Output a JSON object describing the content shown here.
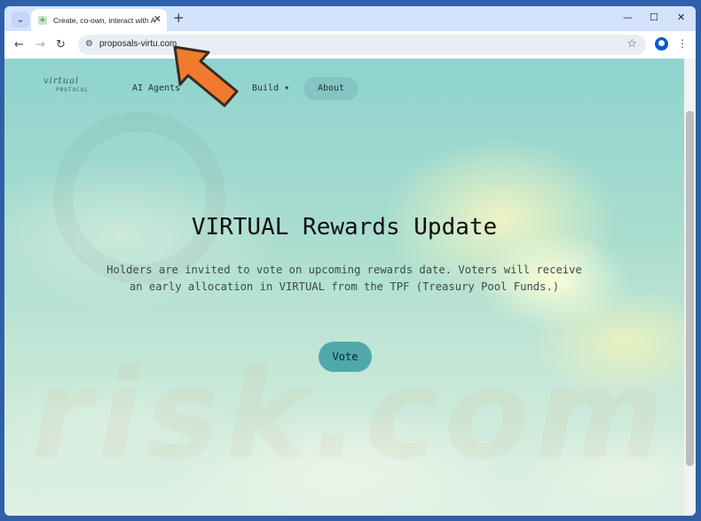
{
  "browser": {
    "tab_title": "Create, co-own, interact with AI Agents",
    "tab_close": "✕",
    "new_tab": "+",
    "url": "proposals-virtu.com",
    "controls": {
      "minimize": "—",
      "maximize": "☐",
      "close": "✕"
    }
  },
  "site": {
    "logo_mark": "virtual",
    "logo_sub": "PROTOCOL",
    "nav": [
      {
        "label": "AI Agents"
      },
      {
        "label": "Build ▾"
      },
      {
        "label": "About"
      }
    ],
    "headline": "VIRTUAL Rewards Update",
    "subtext": "Holders are invited to vote on upcoming rewards date. Voters will receive an early allocation in VIRTUAL from the TPF (Treasury Pool Funds.)",
    "vote_label": "Vote"
  },
  "colors": {
    "accent": "#4fa9ab",
    "arrow": "#f07b2e"
  }
}
